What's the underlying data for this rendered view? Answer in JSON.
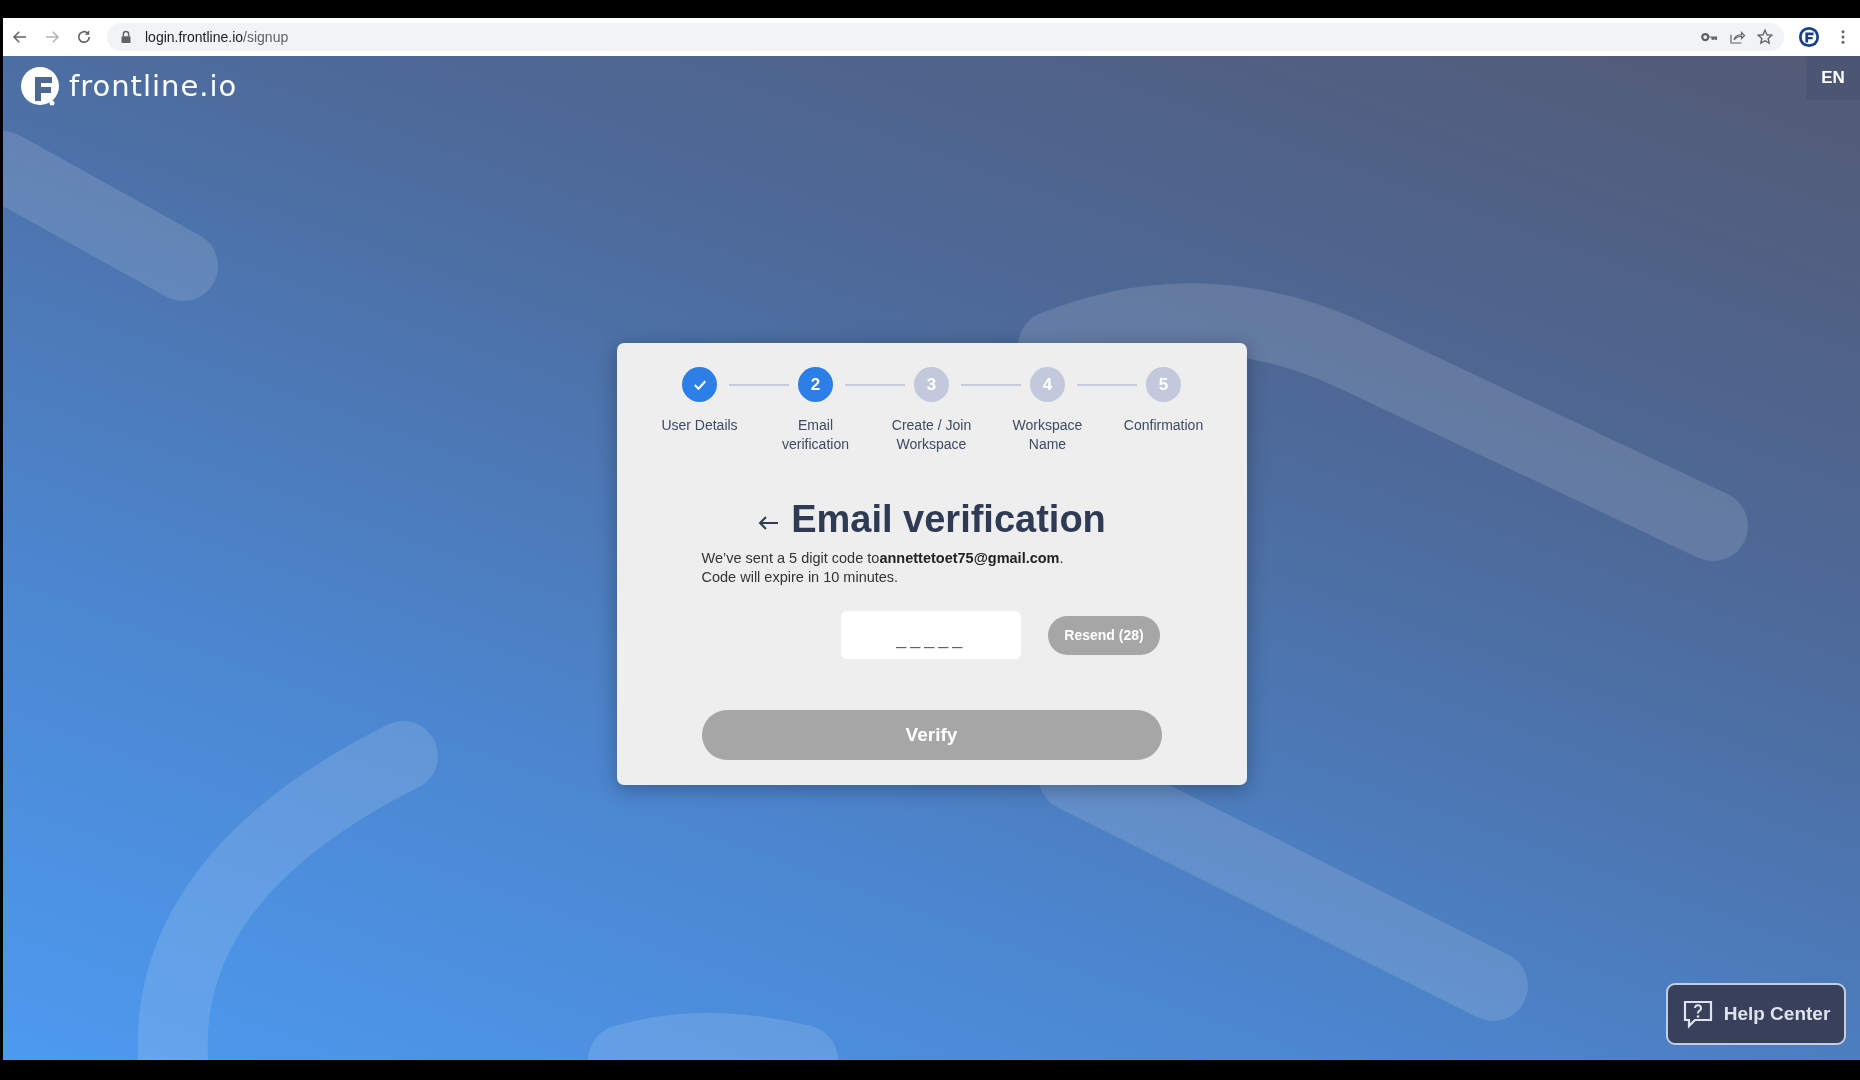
{
  "browser": {
    "url_host": "login.frontline.io",
    "url_path": "/signup",
    "forward_disabled": true
  },
  "brand": {
    "name": "frontline.io"
  },
  "language": "EN",
  "steps": [
    {
      "label": "User Details",
      "kind": "done"
    },
    {
      "number": "2",
      "label": "Email verification",
      "kind": "current"
    },
    {
      "number": "3",
      "label": "Create / Join Workspace",
      "kind": "upcoming"
    },
    {
      "number": "4",
      "label": "Workspace Name",
      "kind": "upcoming"
    },
    {
      "number": "5",
      "label": "Confirmation",
      "kind": "upcoming"
    }
  ],
  "heading": "Email verification",
  "message": "We’ve sent a 5 digit code to**annettetoet75@gmail.com**.",
  "expiry_note": "Code will expire in 10 minutes.",
  "code_field": {
    "placeholder": "_____"
  },
  "resend_button": {
    "label": "Resend (28)",
    "disabled": true
  },
  "verify_button": {
    "label": "Verify",
    "disabled": true
  },
  "help_button": {
    "label": "Help Center"
  }
}
